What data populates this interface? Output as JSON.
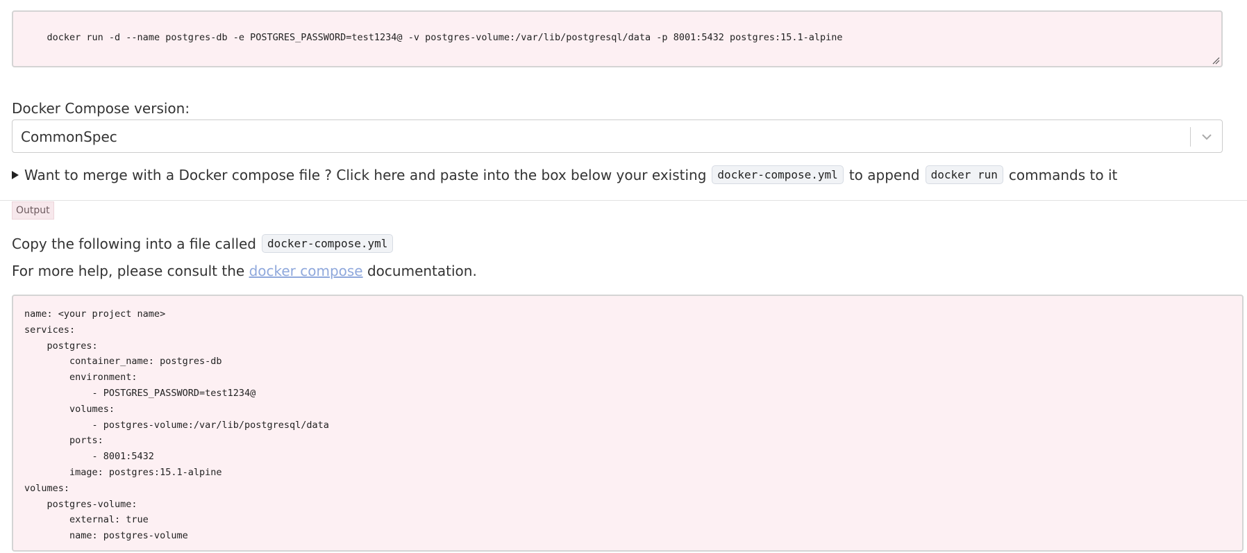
{
  "input": {
    "docker_run_command": "docker run -d --name postgres-db -e POSTGRES_PASSWORD=test1234@ -v postgres-volume:/var/lib/postgresql/data -p 8001:5432 postgres:15.1-alpine"
  },
  "compose_version": {
    "label": "Docker Compose version:",
    "selected": "CommonSpec"
  },
  "merge": {
    "text_before": "Want to merge with a Docker compose file ? Click here and paste into the box below your existing",
    "chip_file": "docker-compose.yml",
    "text_middle": "to append",
    "chip_cmd": "docker run",
    "text_after": "commands to it"
  },
  "output": {
    "tag": "Output",
    "copy_text": "Copy the following into a file called",
    "copy_chip": "docker-compose.yml",
    "help_before": "For more help, please consult the",
    "help_link": "docker compose",
    "help_after": "documentation.",
    "yaml_lines": [
      "name: <your project name>",
      "services:",
      "    postgres:",
      "        container_name: postgres-db",
      "        environment:",
      "            - POSTGRES_PASSWORD=test1234@",
      "        volumes:",
      "            - postgres-volume:/var/lib/postgresql/data",
      "        ports:",
      "            - 8001:5432",
      "        image: postgres:15.1-alpine",
      "volumes:",
      "    postgres-volume:",
      "        external: true",
      "        name: postgres-volume"
    ]
  },
  "icons": {
    "dropdown": "chevron-down-icon",
    "details": "triangle-right-icon",
    "resize": "resize-grip-icon"
  },
  "colors": {
    "code_bg": "#fdf0f3",
    "link": "#8fa8dc"
  }
}
